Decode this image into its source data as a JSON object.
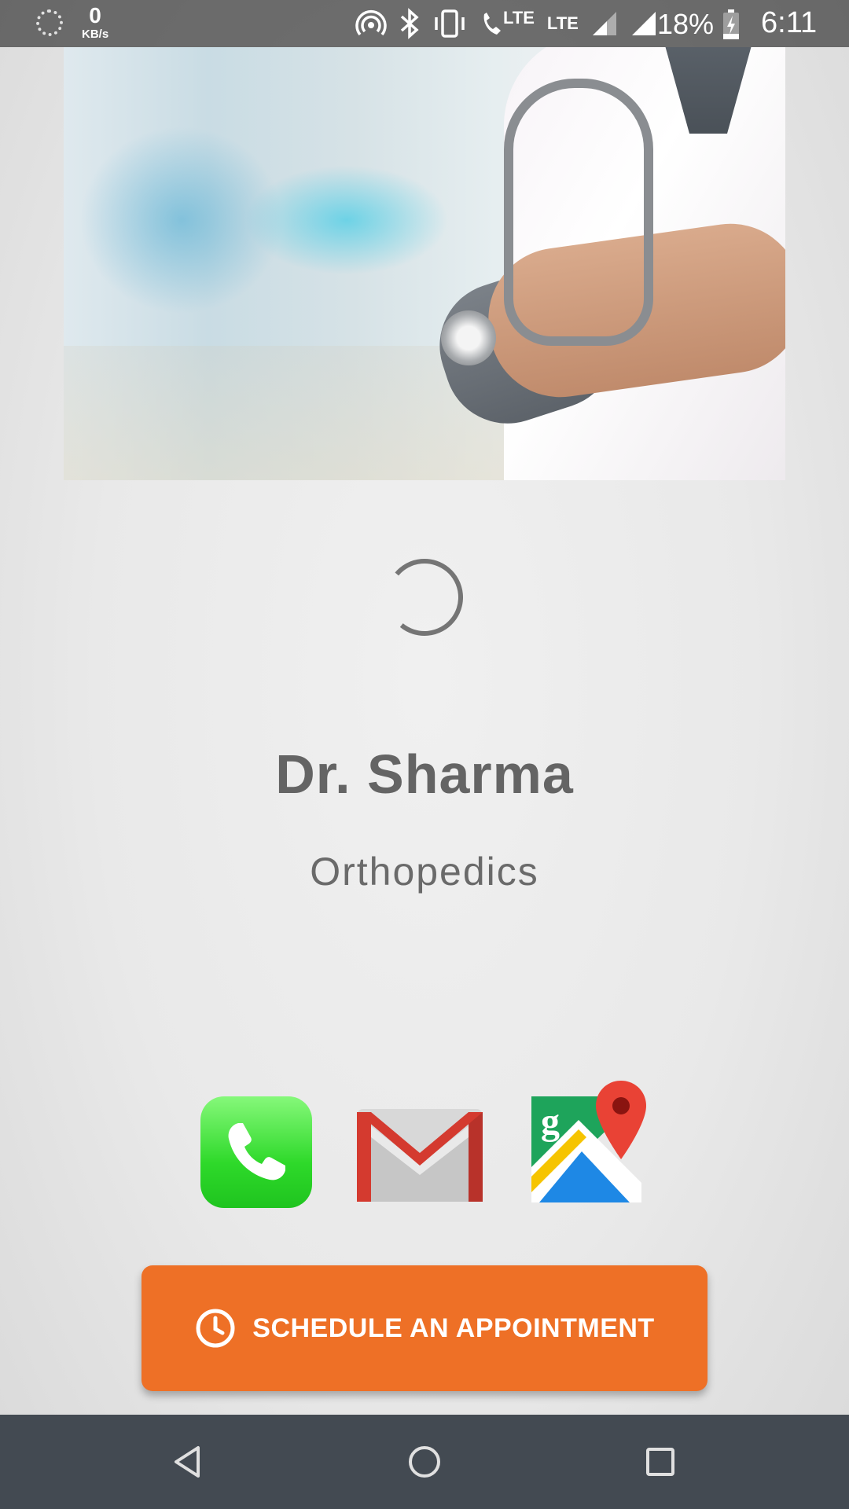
{
  "status_bar": {
    "net_speed_value": "0",
    "net_speed_unit": "KB/s",
    "lte_call_label": "LTE",
    "lte_label": "LTE",
    "battery_percent": "18%",
    "time": "6:11"
  },
  "doctor": {
    "name": "Dr. Sharma",
    "specialty": "Orthopedics"
  },
  "contacts": {
    "phone_icon": "phone-icon",
    "gmail_icon": "gmail-icon",
    "maps_icon": "google-maps-icon"
  },
  "appointment_button": {
    "label": "SCHEDULE AN APPOINTMENT",
    "icon": "clock-icon",
    "color": "#ee7026"
  },
  "colors": {
    "accent": "#ee7026",
    "nav_bar": "#434a52",
    "text": "#646464"
  }
}
